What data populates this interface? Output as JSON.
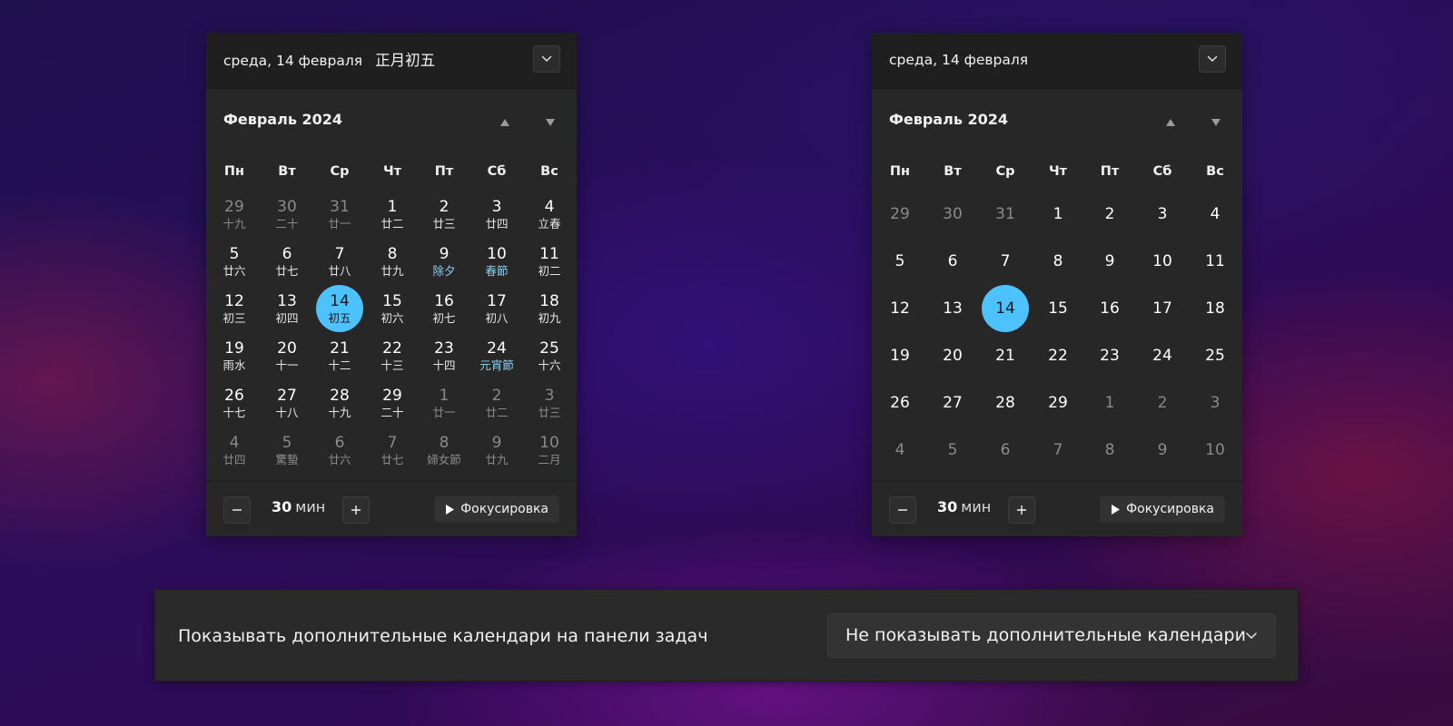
{
  "left_calendar": {
    "header_date": "среда, 14 февраля",
    "header_lunar": "正月初五",
    "month_title": "Февраль 2024",
    "weekdays": [
      "Пн",
      "Вт",
      "Ср",
      "Чт",
      "Пт",
      "Сб",
      "Вс"
    ],
    "weeks": [
      [
        {
          "n": "29",
          "l": "十九",
          "out": true
        },
        {
          "n": "30",
          "l": "二十",
          "out": true
        },
        {
          "n": "31",
          "l": "廿一",
          "out": true
        },
        {
          "n": "1",
          "l": "廿二"
        },
        {
          "n": "2",
          "l": "廿三"
        },
        {
          "n": "3",
          "l": "廿四"
        },
        {
          "n": "4",
          "l": "立春"
        }
      ],
      [
        {
          "n": "5",
          "l": "廿六"
        },
        {
          "n": "6",
          "l": "廿七"
        },
        {
          "n": "7",
          "l": "廿八"
        },
        {
          "n": "8",
          "l": "廿九"
        },
        {
          "n": "9",
          "l": "除夕",
          "fest": true
        },
        {
          "n": "10",
          "l": "春節",
          "fest": true
        },
        {
          "n": "11",
          "l": "初二"
        }
      ],
      [
        {
          "n": "12",
          "l": "初三"
        },
        {
          "n": "13",
          "l": "初四"
        },
        {
          "n": "14",
          "l": "初五",
          "today": true
        },
        {
          "n": "15",
          "l": "初六"
        },
        {
          "n": "16",
          "l": "初七"
        },
        {
          "n": "17",
          "l": "初八"
        },
        {
          "n": "18",
          "l": "初九"
        }
      ],
      [
        {
          "n": "19",
          "l": "雨水"
        },
        {
          "n": "20",
          "l": "十一"
        },
        {
          "n": "21",
          "l": "十二"
        },
        {
          "n": "22",
          "l": "十三"
        },
        {
          "n": "23",
          "l": "十四"
        },
        {
          "n": "24",
          "l": "元宵節",
          "fest": true
        },
        {
          "n": "25",
          "l": "十六"
        }
      ],
      [
        {
          "n": "26",
          "l": "十七"
        },
        {
          "n": "27",
          "l": "十八"
        },
        {
          "n": "28",
          "l": "十九"
        },
        {
          "n": "29",
          "l": "二十"
        },
        {
          "n": "1",
          "l": "廿一",
          "out": true
        },
        {
          "n": "2",
          "l": "廿二",
          "out": true
        },
        {
          "n": "3",
          "l": "廿三",
          "out": true
        }
      ],
      [
        {
          "n": "4",
          "l": "廿四",
          "out": true
        },
        {
          "n": "5",
          "l": "驚蟄",
          "out": true
        },
        {
          "n": "6",
          "l": "廿六",
          "out": true
        },
        {
          "n": "7",
          "l": "廿七",
          "out": true
        },
        {
          "n": "8",
          "l": "婦女節",
          "out": true
        },
        {
          "n": "9",
          "l": "廿九",
          "out": true
        },
        {
          "n": "10",
          "l": "二月",
          "out": true
        }
      ]
    ],
    "timer_value": "30",
    "timer_unit": "мин",
    "focus_label": "Фокусировка"
  },
  "right_calendar": {
    "header_date": "среда, 14 февраля",
    "month_title": "Февраль 2024",
    "weekdays": [
      "Пн",
      "Вт",
      "Ср",
      "Чт",
      "Пт",
      "Сб",
      "Вс"
    ],
    "weeks": [
      [
        {
          "n": "29",
          "out": true
        },
        {
          "n": "30",
          "out": true
        },
        {
          "n": "31",
          "out": true
        },
        {
          "n": "1"
        },
        {
          "n": "2"
        },
        {
          "n": "3"
        },
        {
          "n": "4"
        }
      ],
      [
        {
          "n": "5"
        },
        {
          "n": "6"
        },
        {
          "n": "7"
        },
        {
          "n": "8"
        },
        {
          "n": "9"
        },
        {
          "n": "10"
        },
        {
          "n": "11"
        }
      ],
      [
        {
          "n": "12"
        },
        {
          "n": "13"
        },
        {
          "n": "14",
          "today": true
        },
        {
          "n": "15"
        },
        {
          "n": "16"
        },
        {
          "n": "17"
        },
        {
          "n": "18"
        }
      ],
      [
        {
          "n": "19"
        },
        {
          "n": "20"
        },
        {
          "n": "21"
        },
        {
          "n": "22"
        },
        {
          "n": "23"
        },
        {
          "n": "24"
        },
        {
          "n": "25"
        }
      ],
      [
        {
          "n": "26"
        },
        {
          "n": "27"
        },
        {
          "n": "28"
        },
        {
          "n": "29"
        },
        {
          "n": "1",
          "out": true
        },
        {
          "n": "2",
          "out": true
        },
        {
          "n": "3",
          "out": true
        }
      ],
      [
        {
          "n": "4",
          "out": true
        },
        {
          "n": "5",
          "out": true
        },
        {
          "n": "6",
          "out": true
        },
        {
          "n": "7",
          "out": true
        },
        {
          "n": "8",
          "out": true
        },
        {
          "n": "9",
          "out": true
        },
        {
          "n": "10",
          "out": true
        }
      ]
    ],
    "timer_value": "30",
    "timer_unit": "мин",
    "focus_label": "Фокусировка"
  },
  "settings": {
    "label": "Показывать дополнительные календари на панели задач",
    "dropdown_value": "Не показывать дополнительные календари"
  },
  "colors": {
    "accent": "#4cc2ff",
    "festival_text": "#8fd1f3",
    "panel_bg": "#272727",
    "header_bg": "#1f1f1f"
  },
  "icons": [
    "chevron-down-icon",
    "triangle-up-icon",
    "triangle-down-icon",
    "minus-icon",
    "plus-icon",
    "play-icon"
  ]
}
